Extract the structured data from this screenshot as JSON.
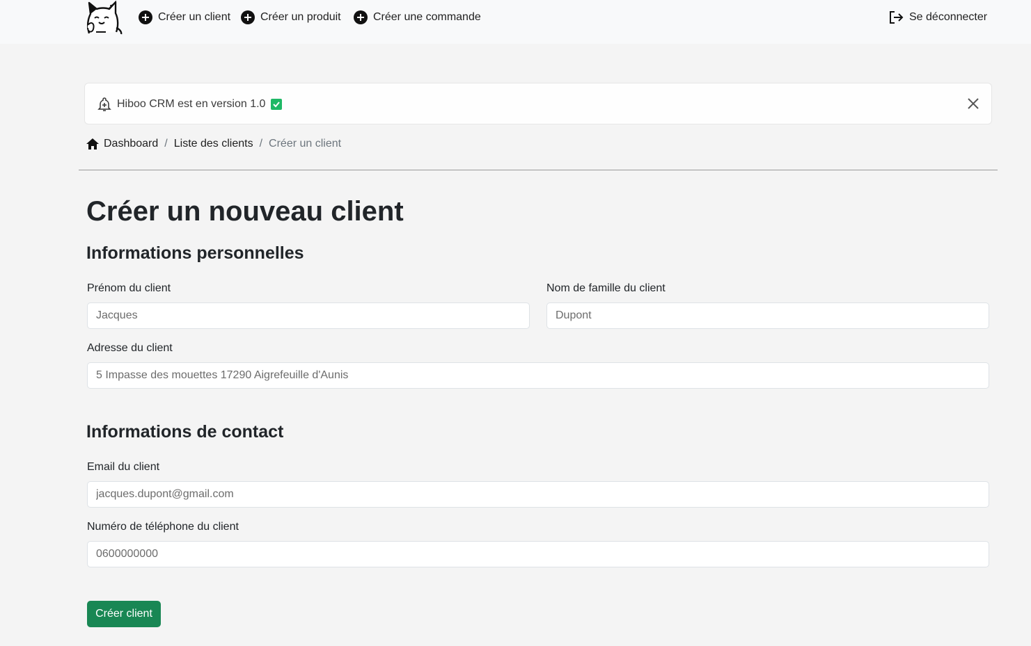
{
  "nav": {
    "create_client": "Créer un client",
    "create_product": "Créer un produit",
    "create_order": "Créer une commande",
    "logout": "Se déconnecter"
  },
  "alert": {
    "message": "Hiboo CRM est en version 1.0",
    "icon": "bell-plus-icon",
    "status_icon": "check-square-icon",
    "accent": "#1fb866"
  },
  "breadcrumb": {
    "dashboard": "Dashboard",
    "clients_list": "Liste des clients",
    "current": "Créer un client",
    "separator": "/"
  },
  "page": {
    "title": "Créer un nouveau client"
  },
  "sections": {
    "personal": "Informations personnelles",
    "contact": "Informations de contact"
  },
  "form": {
    "first_name": {
      "label": "Prénom du client",
      "placeholder": "Jacques"
    },
    "last_name": {
      "label": "Nom de famille du client",
      "placeholder": "Dupont"
    },
    "address": {
      "label": "Adresse du client",
      "placeholder": "5 Impasse des mouettes 17290 Aigrefeuille d'Aunis"
    },
    "email": {
      "label": "Email du client",
      "placeholder": "jacques.dupont@gmail.com"
    },
    "phone": {
      "label": "Numéro de téléphone du client",
      "placeholder": "0600000000"
    },
    "submit": "Créer client",
    "submit_color": "#198754"
  }
}
